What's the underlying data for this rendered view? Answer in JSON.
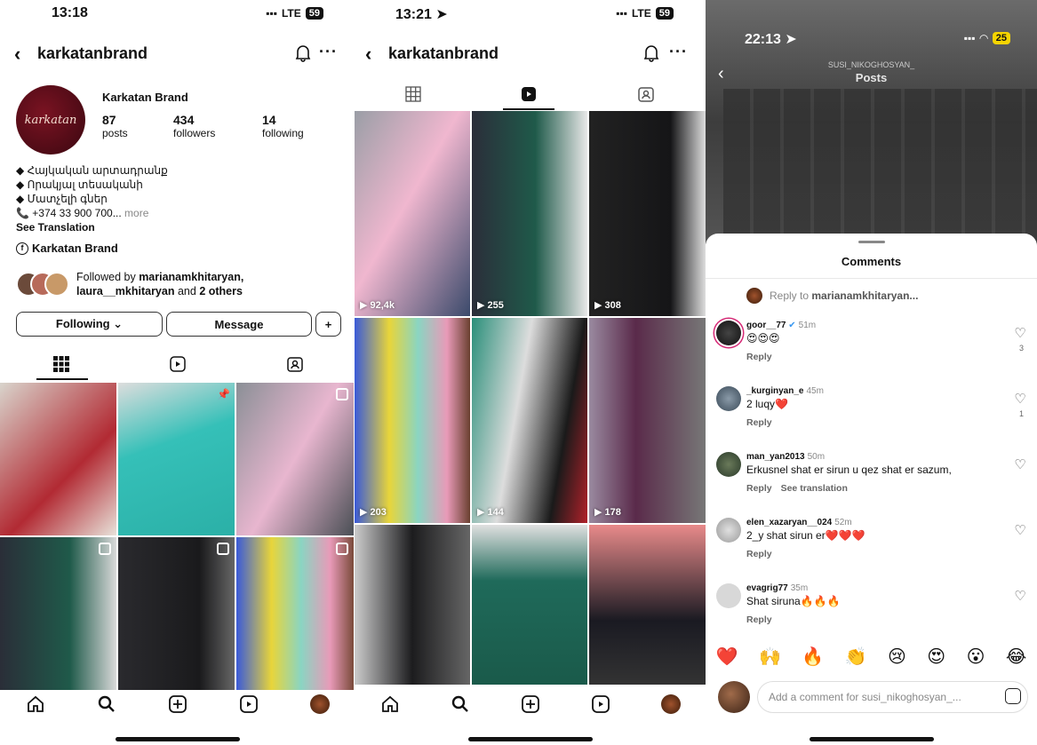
{
  "panel1": {
    "status": {
      "time": "13:18",
      "network": "LTE",
      "battery": "59"
    },
    "header": {
      "username": "karkatanbrand",
      "more": "···"
    },
    "profile": {
      "name": "Karkatan Brand",
      "avatar_text": "karkatan",
      "posts_count": "87",
      "posts_label": "posts",
      "followers_count": "434",
      "followers_label": "followers",
      "following_count": "14",
      "following_label": "following",
      "bio_lines": [
        "◆ Հայկական արտադրանք",
        "◆ Որակյալ տեսականի",
        "◆ Մատչելի գներ"
      ],
      "phone": "📞 +374 33 900 700...",
      "more": "more",
      "see_translation": "See Translation",
      "link_label": "Karkatan Brand",
      "followed_by": "Followed by",
      "followed_user1": "marianamkhitaryan,",
      "followed_user2": "laura__mkhitaryan",
      "followed_and": "and",
      "followed_others": "2 others"
    },
    "buttons": {
      "following": "Following ⌄",
      "message": "Message",
      "add_person": "+"
    }
  },
  "panel2": {
    "status": {
      "time": "13:21",
      "network": "LTE",
      "battery": "59"
    },
    "header": {
      "username": "karkatanbrand",
      "more": "···"
    },
    "views": [
      "92,4k",
      "255",
      "308",
      "203",
      "144",
      "178"
    ]
  },
  "panel3": {
    "status": {
      "time": "22:13",
      "battery": "25"
    },
    "header": {
      "account": "SUSI_NIKOGHOSYAN_",
      "title": "Posts"
    },
    "sheet_title": "Comments",
    "reply_to_prefix": "Reply to",
    "reply_to_user": "marianamkhitaryan...",
    "comments": [
      {
        "user": "goor__77",
        "time": "51m",
        "text": "😍😍😍",
        "reply": "Reply",
        "likes": "3"
      },
      {
        "user": "_kurginyan_e",
        "time": "45m",
        "text": "2 luqy❤️",
        "reply": "Reply",
        "likes": "1"
      },
      {
        "user": "man_yan2013",
        "time": "50m",
        "text": "Erkusnel shat er sirun u qez shat er sazum,",
        "reply": "Reply",
        "see_translation": "See translation",
        "likes": ""
      },
      {
        "user": "elen_xazaryan__024",
        "time": "52m",
        "text": "2_y shat sirun er❤️❤️❤️",
        "reply": "Reply",
        "likes": ""
      },
      {
        "user": "evagrig77",
        "time": "35m",
        "text": "Shat siruna🔥🔥🔥",
        "reply": "Reply",
        "likes": ""
      }
    ],
    "emojis": [
      "❤️",
      "🙌",
      "🔥",
      "👏",
      "😢",
      "😍",
      "😮",
      "😂"
    ],
    "input_placeholder": "Add a comment for susi_nikoghosyan_..."
  }
}
